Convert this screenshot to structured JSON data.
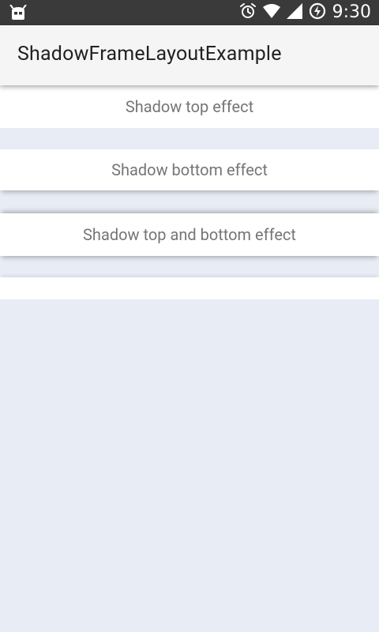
{
  "status_bar": {
    "time": "9:30",
    "icons": [
      "android-debug-icon",
      "alarm-icon",
      "wifi-icon",
      "signal-icon",
      "battery-charging-icon"
    ]
  },
  "app_bar": {
    "title": "ShadowFrameLayoutExample"
  },
  "rows": [
    {
      "label": "Shadow top effect"
    },
    {
      "label": "Shadow bottom effect"
    },
    {
      "label": "Shadow top and bottom effect"
    },
    {
      "label": ""
    }
  ],
  "colors": {
    "status_bar_bg": "#3a3a3a",
    "app_bar_bg": "#f5f5f5",
    "page_bg": "#e8ecf4",
    "row_bg": "#ffffff",
    "row_text": "#757575"
  }
}
